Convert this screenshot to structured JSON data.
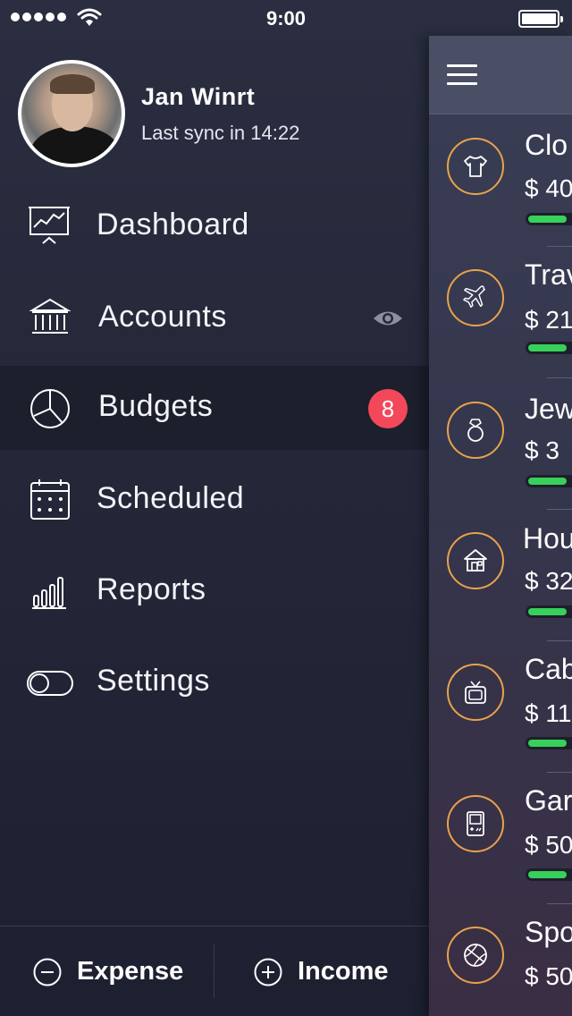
{
  "status_bar": {
    "time": "9:00",
    "signal_dots": 5
  },
  "profile": {
    "name": "Jan Winrt",
    "sync_text": "Last sync in 14:22"
  },
  "menu": {
    "dashboard": "Dashboard",
    "accounts": "Accounts",
    "budgets": "Budgets",
    "budgets_badge": "8",
    "scheduled": "Scheduled",
    "reports": "Reports",
    "settings": "Settings",
    "active": "budgets"
  },
  "bottom": {
    "expense_label": "Expense",
    "income_label": "Income"
  },
  "budgets": [
    {
      "name": "Clo",
      "amount": "$ 40",
      "icon": "shirt-icon",
      "progress": 0.8
    },
    {
      "name": "Trav",
      "amount": "$ 21",
      "icon": "airplane-icon",
      "progress": 0.8
    },
    {
      "name": "Jew",
      "amount": "$ 3",
      "icon": "ring-icon",
      "progress": 0.8
    },
    {
      "name": "Hou",
      "amount": "$ 32",
      "icon": "house-icon",
      "progress": 0.8
    },
    {
      "name": "Cab",
      "amount": "$ 11",
      "icon": "tv-icon",
      "progress": 0.8
    },
    {
      "name": "Gar",
      "amount": "$ 50",
      "icon": "gameboy-icon",
      "progress": 0.8
    },
    {
      "name": "Spo",
      "amount": "$ 50",
      "icon": "basketball-icon",
      "progress": 0.8
    }
  ],
  "colors": {
    "accent_orange": "#e9a24c",
    "progress_green": "#37d05b",
    "badge_red": "#f2485a",
    "drawer_bg": "#252839",
    "active_row_bg": "#1c1f2c"
  }
}
